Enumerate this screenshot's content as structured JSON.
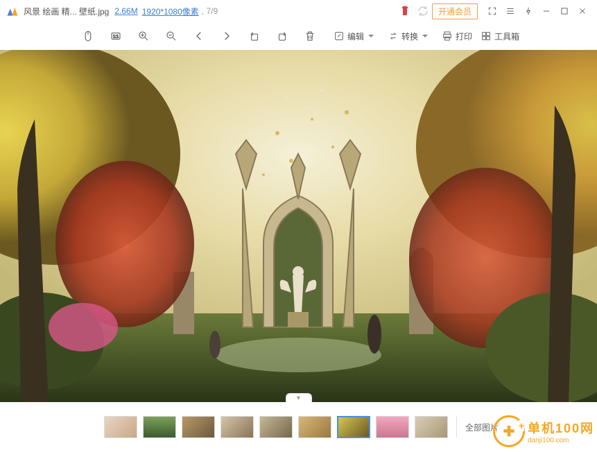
{
  "titlebar": {
    "filename": "风景 绘画 精... 壁纸.jpg",
    "filesize": "2.66M",
    "dimensions": "1920*1080像素",
    "index": ", 7/9",
    "vip_label": "开通会员"
  },
  "toolbar": {
    "edit_label": "编辑",
    "convert_label": "转换",
    "print_label": "打印",
    "toolbox_label": "工具箱"
  },
  "thumbbar": {
    "all_pics_label": "全部图片"
  },
  "watermark": {
    "cn": "单机100网",
    "en": "danji100.com"
  }
}
